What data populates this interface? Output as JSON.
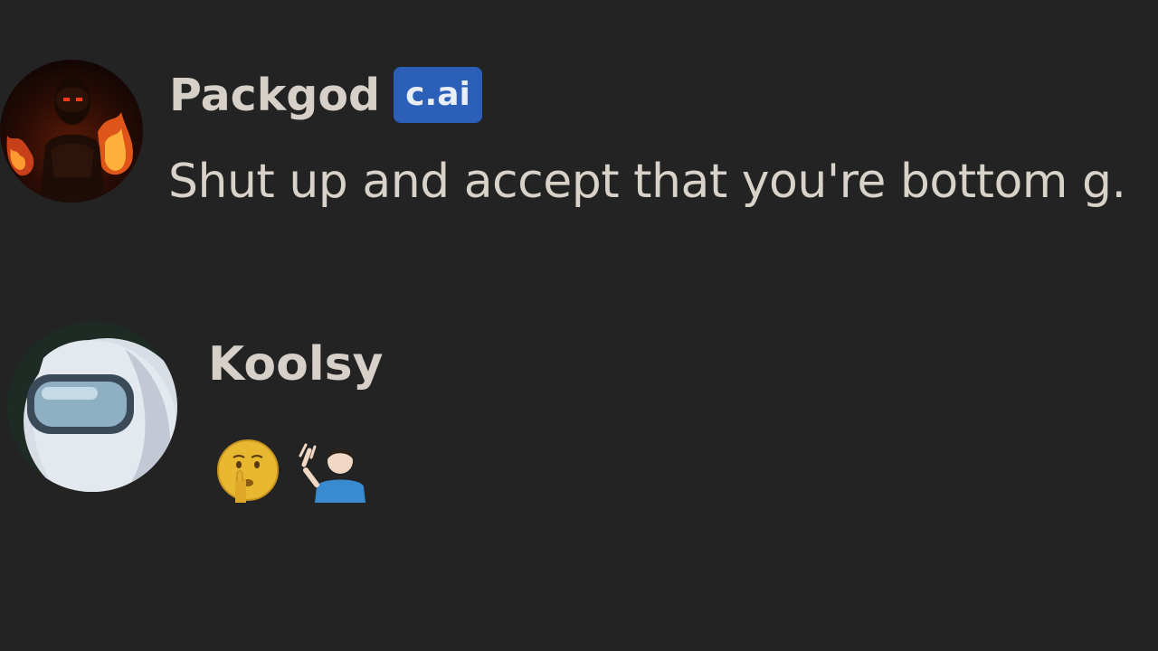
{
  "messages": [
    {
      "username": "Packgod",
      "badge": "c.ai",
      "text": "Shut up and accept that you're bottom g."
    },
    {
      "username": "Koolsy",
      "emojis": [
        "shushing-face-emoji",
        "person-tipping-hand-emoji"
      ]
    }
  ],
  "colors": {
    "background": "#232323",
    "username": "#d6d0c8",
    "message_text": "#d8d2c8",
    "badge_bg": "#2b5fb8"
  }
}
